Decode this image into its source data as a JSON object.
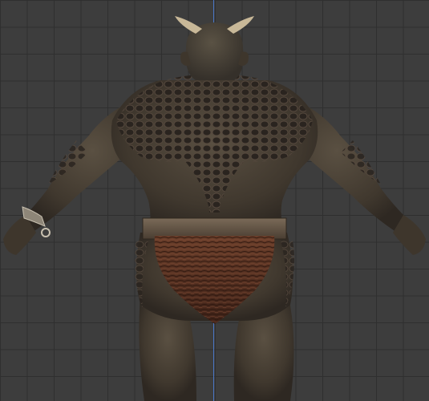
{
  "viewport": {
    "grid_color": "#2f2f2f",
    "background_color": "#3d3d3d",
    "z_axis_color": "#4a78c8"
  },
  "model": {
    "subject": "orc-character-back-view",
    "skin_color": "#4a4236",
    "scale_color": "#2a2420",
    "loincloth_color": "#5a3526",
    "belt_color": "#6a5a48",
    "horn_color": "#c8b898"
  },
  "icons": {
    "bracelet": "bracelet-icon"
  }
}
